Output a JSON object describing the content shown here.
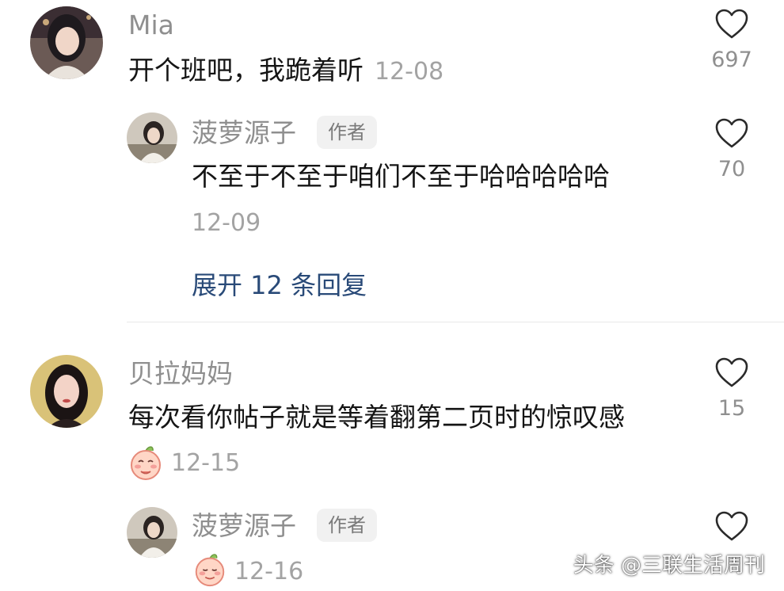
{
  "comments": [
    {
      "user": "Mia",
      "text": "开个班吧，我跪着听",
      "date": "12-08",
      "likes": "697",
      "avatar": "user-avatar",
      "replies": [
        {
          "user": "菠萝源子",
          "badge": "作者",
          "text": "不至于不至于咱们不至于哈哈哈哈哈",
          "date": "12-09",
          "likes": "70",
          "avatar": "author-avatar"
        }
      ],
      "expand_label": "展开 12 条回复"
    },
    {
      "user": "贝拉妈妈",
      "text": "每次看你帖子就是等着翻第二页时的惊叹感",
      "date": "12-15",
      "likes": "15",
      "avatar": "user-avatar",
      "sticker": "blushing-peach-sticker",
      "replies": [
        {
          "user": "菠萝源子",
          "badge": "作者",
          "date": "12-16",
          "sticker": "blushing-peach-sticker",
          "avatar": "author-avatar"
        }
      ]
    }
  ],
  "watermark": "头条 @三联生活周刊",
  "colors": {
    "name": "#8f8f8f",
    "text": "#151515",
    "date": "#a3a3a3",
    "expand_link": "#294a78",
    "badge_bg": "#f1f1f1"
  },
  "icons": {
    "like": "heart-outline-icon"
  }
}
